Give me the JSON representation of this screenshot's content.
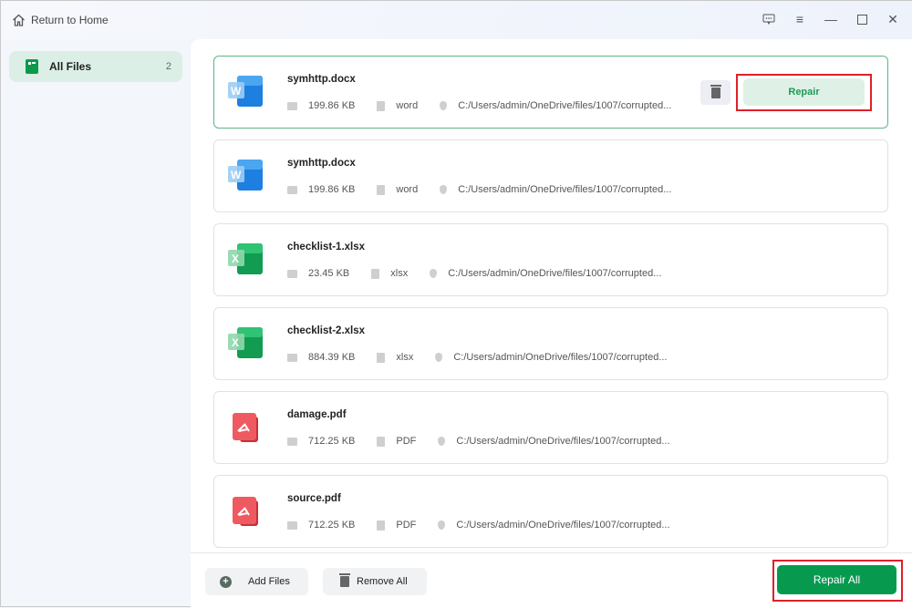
{
  "header": {
    "return_label": "Return to Home"
  },
  "sidebar": {
    "items": [
      {
        "label": "All Files",
        "count": "2"
      }
    ]
  },
  "files": [
    {
      "name": "symhttp.docx",
      "size": "199.86 KB",
      "type": "word",
      "path": "C:/Users/admin/OneDrive/files/1007/corrupted...",
      "kind": "word",
      "selected": true
    },
    {
      "name": "symhttp.docx",
      "size": "199.86 KB",
      "type": "word",
      "path": "C:/Users/admin/OneDrive/files/1007/corrupted...",
      "kind": "word"
    },
    {
      "name": "checklist-1.xlsx",
      "size": "23.45 KB",
      "type": "xlsx",
      "path": "C:/Users/admin/OneDrive/files/1007/corrupted...",
      "kind": "excel"
    },
    {
      "name": "checklist-2.xlsx",
      "size": "884.39 KB",
      "type": "xlsx",
      "path": "C:/Users/admin/OneDrive/files/1007/corrupted...",
      "kind": "excel"
    },
    {
      "name": "damage.pdf",
      "size": "712.25 KB",
      "type": "PDF",
      "path": "C:/Users/admin/OneDrive/files/1007/corrupted...",
      "kind": "pdf"
    },
    {
      "name": "source.pdf",
      "size": "712.25 KB",
      "type": "PDF",
      "path": "C:/Users/admin/OneDrive/files/1007/corrupted...",
      "kind": "pdf"
    }
  ],
  "actions": {
    "repair": "Repair",
    "add_files": "Add Files",
    "remove_all": "Remove All",
    "repair_all": "Repair All"
  },
  "colors": {
    "accent": "#079a4f",
    "highlight": "#e0202a"
  }
}
